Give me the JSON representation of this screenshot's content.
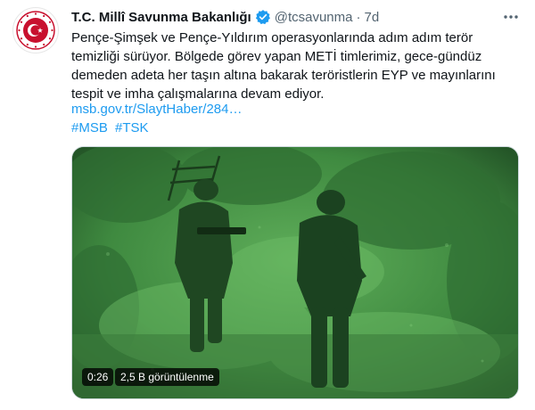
{
  "tweet": {
    "author_name": "T.C. Millî Savunma Bakanlığı",
    "handle": "@tcsavunma",
    "separator": "·",
    "time": "7d",
    "text": "Pençe-Şimşek ve Pençe-Yıldırım operasyonlarında adım adım terör temizliği sürüyor. Bölgede görev yapan METİ timlerimiz, gece-gündüz demeden adeta her taşın altına bakarak teröristlerin EYP ve mayınlarını tespit ve imha çalışmalarına devam ediyor.",
    "link": "msb.gov.tr/SlaytHaber/284…",
    "hashtags": [
      "#MSB",
      "#TSK"
    ],
    "verified_icon": "verified-badge-icon",
    "more_icon": "more-options-icon"
  },
  "video": {
    "duration": "0:26",
    "views": "2,5 B görüntülenme",
    "tint": "#4a8f4a"
  },
  "colors": {
    "accent": "#1d9bf0",
    "text": "#0f1419",
    "secondary": "#536471",
    "logo_red": "#c8102e"
  }
}
